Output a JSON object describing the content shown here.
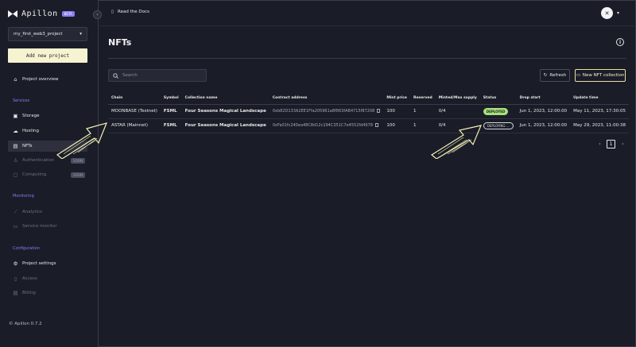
{
  "app": {
    "name": "Apillon",
    "badge": "BETA",
    "version": "© Apillon 0.7.2"
  },
  "sidebar": {
    "project": "my_first_web3_project",
    "new_project": "Add new project",
    "overview": "Project overview",
    "sections": {
      "services": "Services",
      "monitoring": "Monitoring",
      "configuration": "Configuration"
    },
    "items": {
      "storage": "Storage",
      "hosting": "Hosting",
      "nfts": "NFTs",
      "authentication": "Authentication",
      "computing": "Computing",
      "analytics": "Analytics",
      "service_monitor": "Service monitor",
      "project_settings": "Project settings",
      "access": "Access",
      "billing": "Billing"
    },
    "soon": "SOON"
  },
  "topbar": {
    "docs": "Read the Docs"
  },
  "main": {
    "title": "NFTs",
    "search_placeholder": "Search",
    "refresh": "Refresh",
    "new_collection": "New NFT collection"
  },
  "table": {
    "headers": [
      "Chain",
      "Symbol",
      "Collection name",
      "Contract address",
      "Mint price",
      "Reserved",
      "Minted/Max supply",
      "Status",
      "Drop start",
      "Update time"
    ],
    "rows": [
      {
        "chain": "MOONBASE (Testnet)",
        "symbol": "FSML",
        "name": "Four Seasons Magical Landscape",
        "address": "0xb82D133A2EE1Ffa205961a8f863fAB4715f87208",
        "price": "100",
        "reserved": "1",
        "minted": "0/4",
        "status": "DEPLOYED",
        "drop": "Jun 1, 2023, 12:00:00",
        "updated": "May 11, 2023, 17:30:05"
      },
      {
        "chain": "ASTAR (Mainnet)",
        "symbol": "FSML",
        "name": "Four Seasons Magical Landscape",
        "address": "0xFa01fc240ea48C8d12c194C351C7e4552fd4678",
        "price": "100",
        "reserved": "1",
        "minted": "0/4",
        "status": "DEPLOYING ...",
        "drop": "Jun 1, 2023, 12:00:00",
        "updated": "May 29, 2023, 11:00:38"
      }
    ]
  },
  "pagination": {
    "prev": "‹",
    "current": "1",
    "next": "›"
  }
}
